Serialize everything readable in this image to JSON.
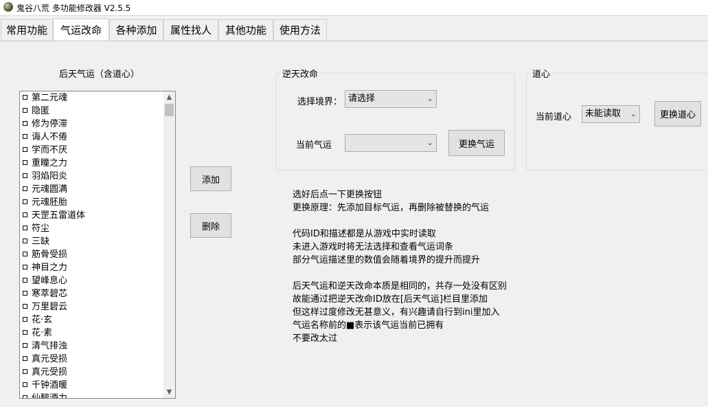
{
  "window": {
    "title": "鬼谷八荒 多功能修改器  V2.5.5",
    "icon": "app-icon"
  },
  "tabs": [
    {
      "label": "常用功能",
      "active": false
    },
    {
      "label": "气运改命",
      "active": true
    },
    {
      "label": "各种添加",
      "active": false
    },
    {
      "label": "属性找人",
      "active": false
    },
    {
      "label": "其他功能",
      "active": false
    },
    {
      "label": "使用方法",
      "active": false
    }
  ],
  "list_section": {
    "label": "后天气运（含道心）",
    "items": [
      "第二元魂",
      "隐匿",
      "修为停滞",
      "诲人不倦",
      "学而不厌",
      "重瞳之力",
      "羽焰阳炎",
      "元魂圆满",
      "元魂胚胎",
      "天罡五雷道体",
      "符尘",
      "三缺",
      "筋骨受损",
      "神目之力",
      "望峰息心",
      "寒萃碧芯",
      "万里碧云",
      "花·玄",
      "花·素",
      "清气排浊",
      "真元受损",
      "真元受损",
      "千钟酒暖",
      "仙醇酒力"
    ]
  },
  "actions": {
    "add_label": "添加",
    "delete_label": "删除"
  },
  "fate_group": {
    "title": "逆天改命",
    "realm_label": "选择境界：",
    "realm_value": "请选择",
    "current_fate_label": "当前气运",
    "current_fate_value": "",
    "change_button": "更换气运"
  },
  "dao_group": {
    "title": "道心",
    "current_label": "当前道心",
    "current_value": "未能读取",
    "change_button": "更换道心"
  },
  "instructions": [
    "选好后点一下更换按钮",
    "更换原理：先添加目标气运，再删除被替换的气运",
    "",
    "代码ID和描述都是从游戏中实时读取",
    "未进入游戏时将无法选择和查看气运词条",
    "部分气运描述里的数值会随着境界的提升而提升",
    "",
    "后天气运和逆天改命本质是相同的，共存一处没有区别",
    "故能通过把逆天改命ID放在[后天气运]栏目里添加",
    "但这样过度修改无甚意义，有兴趣请自行到ini里加入",
    "气运名称前的■表示该气运当前已拥有",
    "不要改太过"
  ]
}
